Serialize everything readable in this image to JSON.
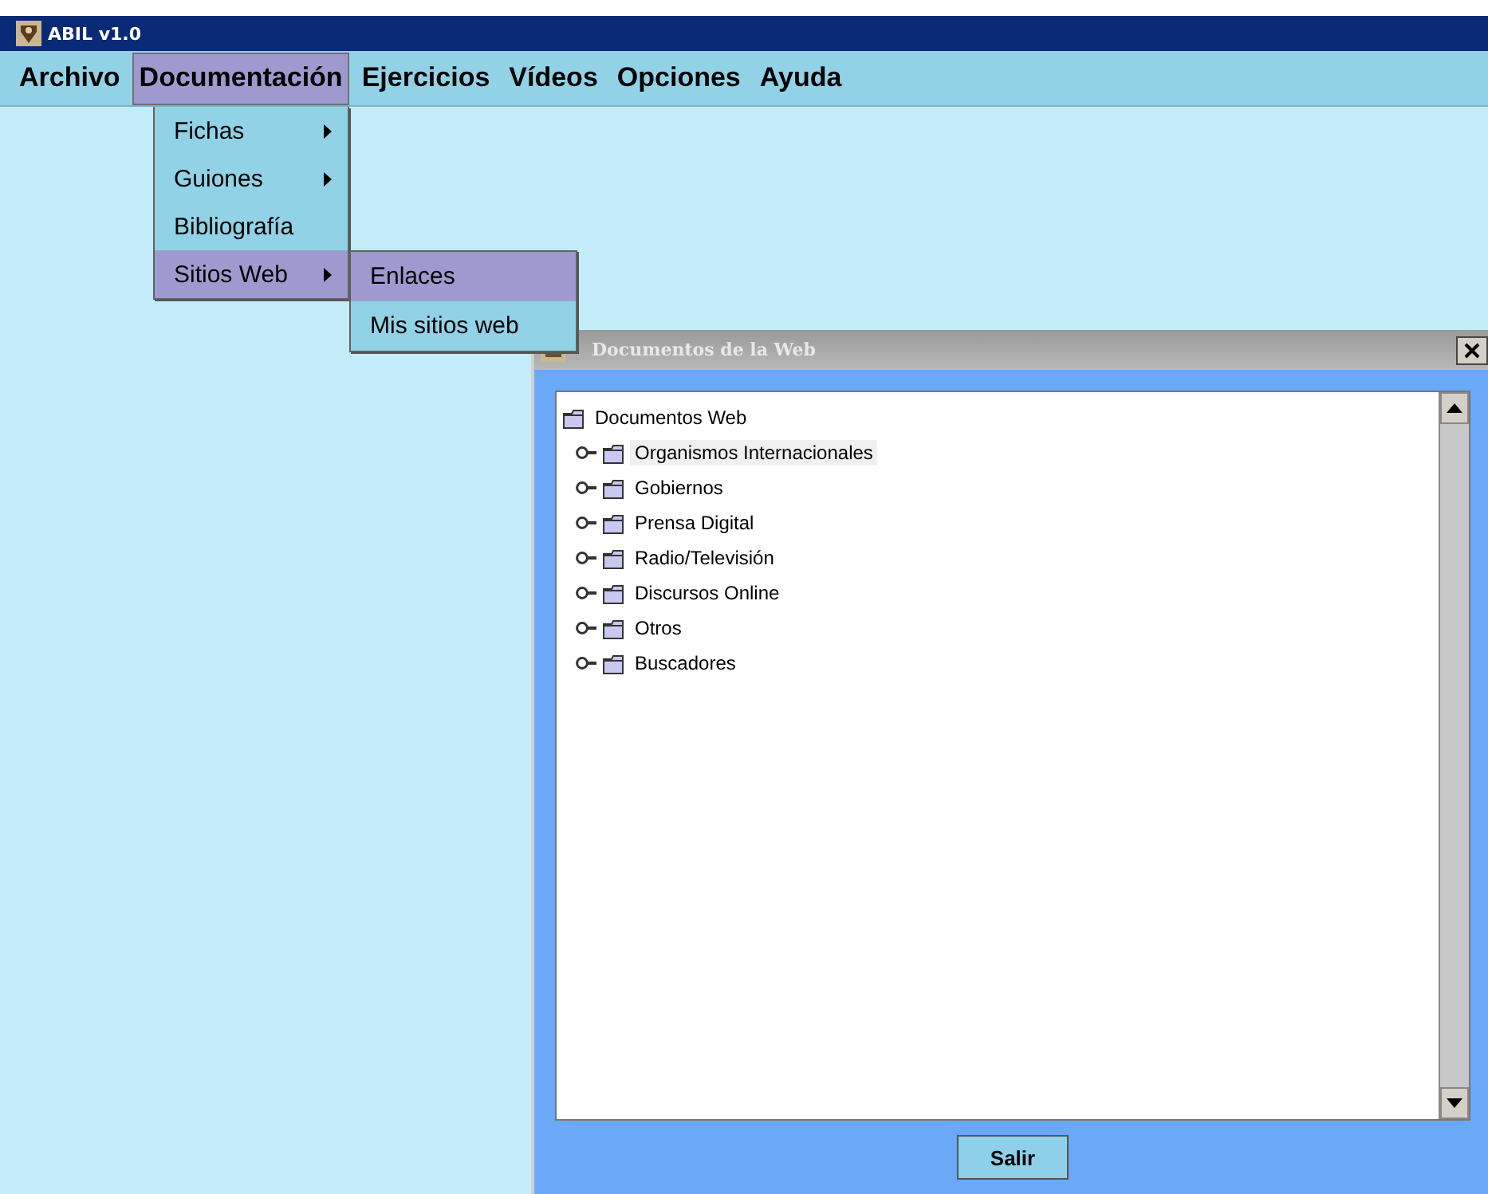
{
  "window": {
    "title": "ABIL v1.0"
  },
  "menu_bar": [
    {
      "label": "Archivo",
      "selected": false
    },
    {
      "label": "Documentación",
      "selected": true
    },
    {
      "label": "Ejercicios",
      "selected": false
    },
    {
      "label": "Vídeos",
      "selected": false
    },
    {
      "label": "Opciones",
      "selected": false
    },
    {
      "label": "Ayuda",
      "selected": false
    }
  ],
  "dropdown": [
    {
      "label": "Fichas",
      "submenu": true,
      "selected": false
    },
    {
      "label": "Guiones",
      "submenu": true,
      "selected": false
    },
    {
      "label": "Bibliografía",
      "submenu": false,
      "selected": false
    },
    {
      "label": "Sitios Web",
      "submenu": true,
      "selected": true
    }
  ],
  "submenu": [
    {
      "label": "Enlaces",
      "selected": true
    },
    {
      "label": "Mis sitios web",
      "selected": false
    }
  ],
  "internal_window": {
    "title": "Documentos de la Web",
    "tree": {
      "label": "Documentos Web",
      "children": [
        {
          "label": "Organismos Internacionales",
          "expanded": false,
          "selected": true
        },
        {
          "label": "Gobiernos",
          "expanded": false,
          "selected": false
        },
        {
          "label": "Prensa Digital",
          "expanded": false,
          "selected": false
        },
        {
          "label": "Radio/Televisión",
          "expanded": false,
          "selected": false
        },
        {
          "label": "Discursos Online",
          "expanded": false,
          "selected": false
        },
        {
          "label": "Otros",
          "expanded": false,
          "selected": false
        },
        {
          "label": "Buscadores",
          "expanded": false,
          "selected": false
        }
      ]
    },
    "buttons": [
      "Salir"
    ]
  }
}
